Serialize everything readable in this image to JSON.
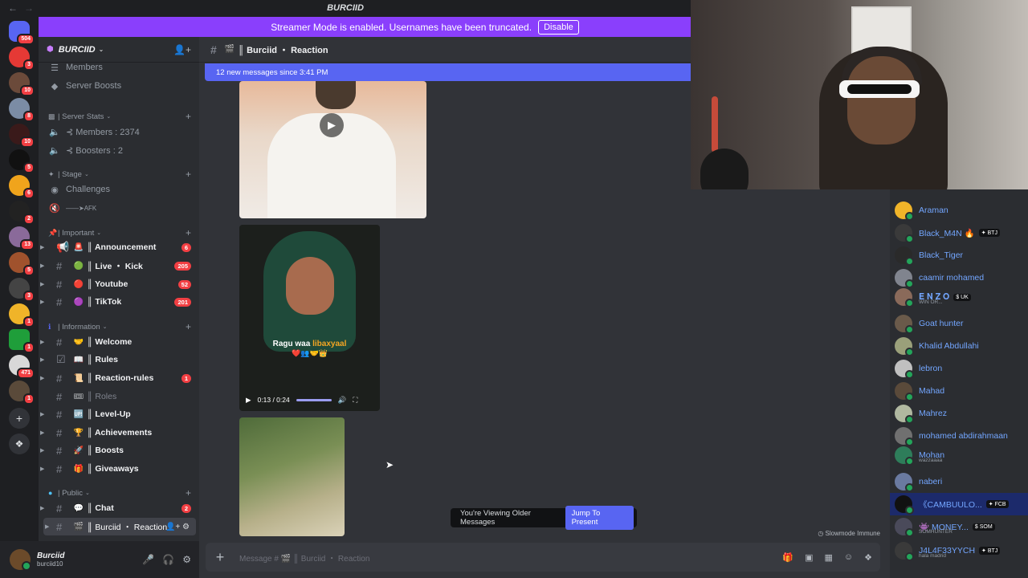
{
  "window": {
    "title": "BURCIID"
  },
  "banner": {
    "text": "Streamer Mode is enabled. Usernames have been truncated.",
    "button": "Disable"
  },
  "rail": {
    "badges": [
      "504",
      "3",
      "10",
      "8",
      "10",
      "5",
      "6",
      "2",
      "13",
      "5",
      "3",
      "1",
      "1",
      "471",
      "1"
    ]
  },
  "server": {
    "name": "BURCIID"
  },
  "sidebar": {
    "top_items": [
      "Members",
      "Server Boosts"
    ],
    "categories": [
      {
        "label": "| Server Stats"
      },
      {
        "label": "| Stage"
      },
      {
        "label": "| Important"
      },
      {
        "label": "| Information"
      },
      {
        "label": "| Public"
      }
    ],
    "stats": [
      "⊰ Members : 2374",
      "⊰ Boosters : 2"
    ],
    "stage_items": [
      "Challenges",
      "——➤AFK"
    ],
    "channels": [
      {
        "label": "║ Announcement",
        "emoji": "🚨",
        "badge": "6"
      },
      {
        "label": "║ Live ・ Kick",
        "emoji": "🟢",
        "badge": "205"
      },
      {
        "label": "║ Youtube",
        "emoji": "🔴",
        "badge": "52"
      },
      {
        "label": "║ TikTok",
        "emoji": "🟣",
        "badge": "201"
      },
      {
        "label": "║ Welcome",
        "emoji": "🤝",
        "badge": ""
      },
      {
        "label": "║ Rules",
        "emoji": "📖",
        "badge": ""
      },
      {
        "label": "║ Reaction-rules",
        "emoji": "📜",
        "badge": "1"
      },
      {
        "label": "║ Roles",
        "emoji": "🎟",
        "badge": ""
      },
      {
        "label": "║ Level-Up",
        "emoji": "🆙",
        "badge": ""
      },
      {
        "label": "║ Achievements",
        "emoji": "🏆",
        "badge": ""
      },
      {
        "label": "║ Boosts",
        "emoji": "🚀",
        "badge": ""
      },
      {
        "label": "║ Giveaways",
        "emoji": "🎁",
        "badge": ""
      },
      {
        "label": "║ Chat",
        "emoji": "💬",
        "badge": "2"
      },
      {
        "label": "║ Burciid ・ Reaction",
        "emoji": "🎬",
        "badge": ""
      }
    ]
  },
  "user": {
    "name": "Burciid",
    "status": "burciid10"
  },
  "channel": {
    "header": "║ Burciid ・ Reaction",
    "new_messages": "12 new messages since 3:41 PM"
  },
  "video2": {
    "caption_white": "Ragu waa ",
    "caption_orange": "libaxyaal",
    "emojis": "❤️👥🤝👑",
    "time": "0:13 / 0:24"
  },
  "older": {
    "text": "You're Viewing Older Messages",
    "button": "Jump To Present"
  },
  "slowmode": "Slowmode Immune",
  "composer": {
    "placeholder": "Message # 🎬 ║ Burciid ・ Reaction"
  },
  "members": [
    {
      "name": "Araman",
      "sub": "",
      "tag": ""
    },
    {
      "name": "Black_M4N 🔥",
      "sub": "",
      "tag": "✦ BTJ"
    },
    {
      "name": "Black_Tiger",
      "sub": "",
      "tag": ""
    },
    {
      "name": "caamir mohamed",
      "sub": "",
      "tag": ""
    },
    {
      "name": "𝐄 𝐍 𝐙 𝐎",
      "sub": "WIN OR...",
      "tag": "$ UK"
    },
    {
      "name": "Goat hunter",
      "sub": "",
      "tag": ""
    },
    {
      "name": "Khalid Abdullahi",
      "sub": "",
      "tag": ""
    },
    {
      "name": "lebron",
      "sub": "",
      "tag": ""
    },
    {
      "name": "Mahad",
      "sub": "",
      "tag": ""
    },
    {
      "name": "Mahrez",
      "sub": "",
      "tag": ""
    },
    {
      "name": "mohamed abdirahmaan",
      "sub": "",
      "tag": ""
    },
    {
      "name": "Mohan",
      "sub": "wazzaaaa",
      "tag": ""
    },
    {
      "name": "naberi",
      "sub": "",
      "tag": ""
    },
    {
      "name": "《CAMBUULO...",
      "sub": "",
      "tag": "✦ FCB"
    },
    {
      "name": "👾 MONEY...",
      "sub": "SOMHUNTER",
      "tag": "$ SOM"
    },
    {
      "name": "J4L4F33YYCH",
      "sub": "hala madrid",
      "tag": "✦ BTJ"
    }
  ],
  "colors": {
    "accent": "#5865f2",
    "streamer_banner": "#8a3ffc",
    "mention": "#f23f43",
    "online": "#23a55a",
    "member_name": "#73a6ff"
  }
}
